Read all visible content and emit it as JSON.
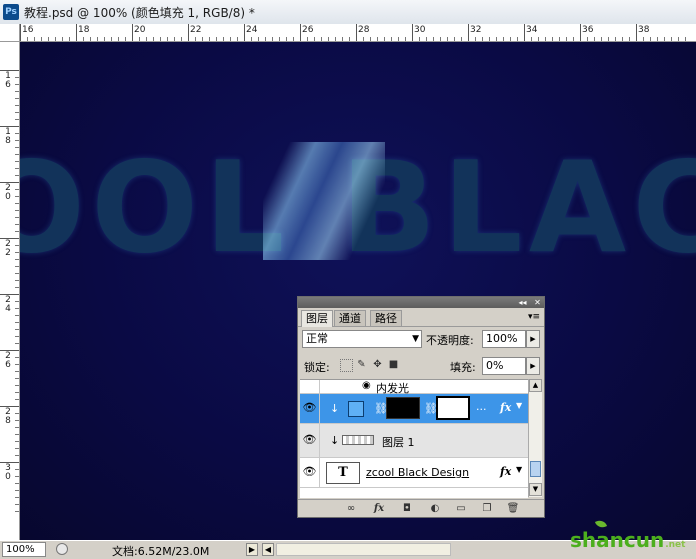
{
  "window": {
    "title": "教程.psd @ 100% (颜色填充 1, RGB/8) *",
    "app_icon": "Ps"
  },
  "rulers": {
    "horizontal": [
      "16",
      "18",
      "20",
      "22",
      "24",
      "26",
      "28",
      "30",
      "32",
      "34",
      "36",
      "38"
    ],
    "vertical": [
      "16",
      "18",
      "20",
      "22",
      "24",
      "26",
      "28",
      "30"
    ]
  },
  "canvas": {
    "text": "OOL BLACK",
    "bg": "#0a0a44",
    "text_color": "#12335a",
    "highlight_color": "#5fb4ff"
  },
  "status": {
    "zoom": "100%",
    "doc_info": "文档:6.52M/23.0M",
    "left_arrow": "◀",
    "right_arrow": "▶"
  },
  "watermark": {
    "text": "shancun",
    "suffix": ".net"
  },
  "layers_panel": {
    "tabs": [
      {
        "label": "图层",
        "active": true
      },
      {
        "label": "通道",
        "active": false
      },
      {
        "label": "路径",
        "active": false
      }
    ],
    "blend_mode": "正常",
    "opacity_label": "不透明度:",
    "opacity": "100%",
    "lock_label": "锁定:",
    "fill_label": "填充:",
    "fill": "0%",
    "effect_row": "内发光",
    "layers": [
      {
        "name": "",
        "selected": true,
        "type": "fill",
        "thumb_color": "#4aa2ee",
        "dots": "...",
        "fx": "fx"
      },
      {
        "name": "图层 1",
        "selected": false,
        "type": "pixel"
      },
      {
        "name": "zcool Black Design",
        "selected": false,
        "type": "text",
        "thumb_letter": "T",
        "fx": "fx"
      }
    ],
    "bottom_icons": [
      "link-icon",
      "fx-icon",
      "mask-icon",
      "adjustment-icon",
      "folder-icon",
      "new-layer-icon",
      "trash-icon"
    ]
  }
}
